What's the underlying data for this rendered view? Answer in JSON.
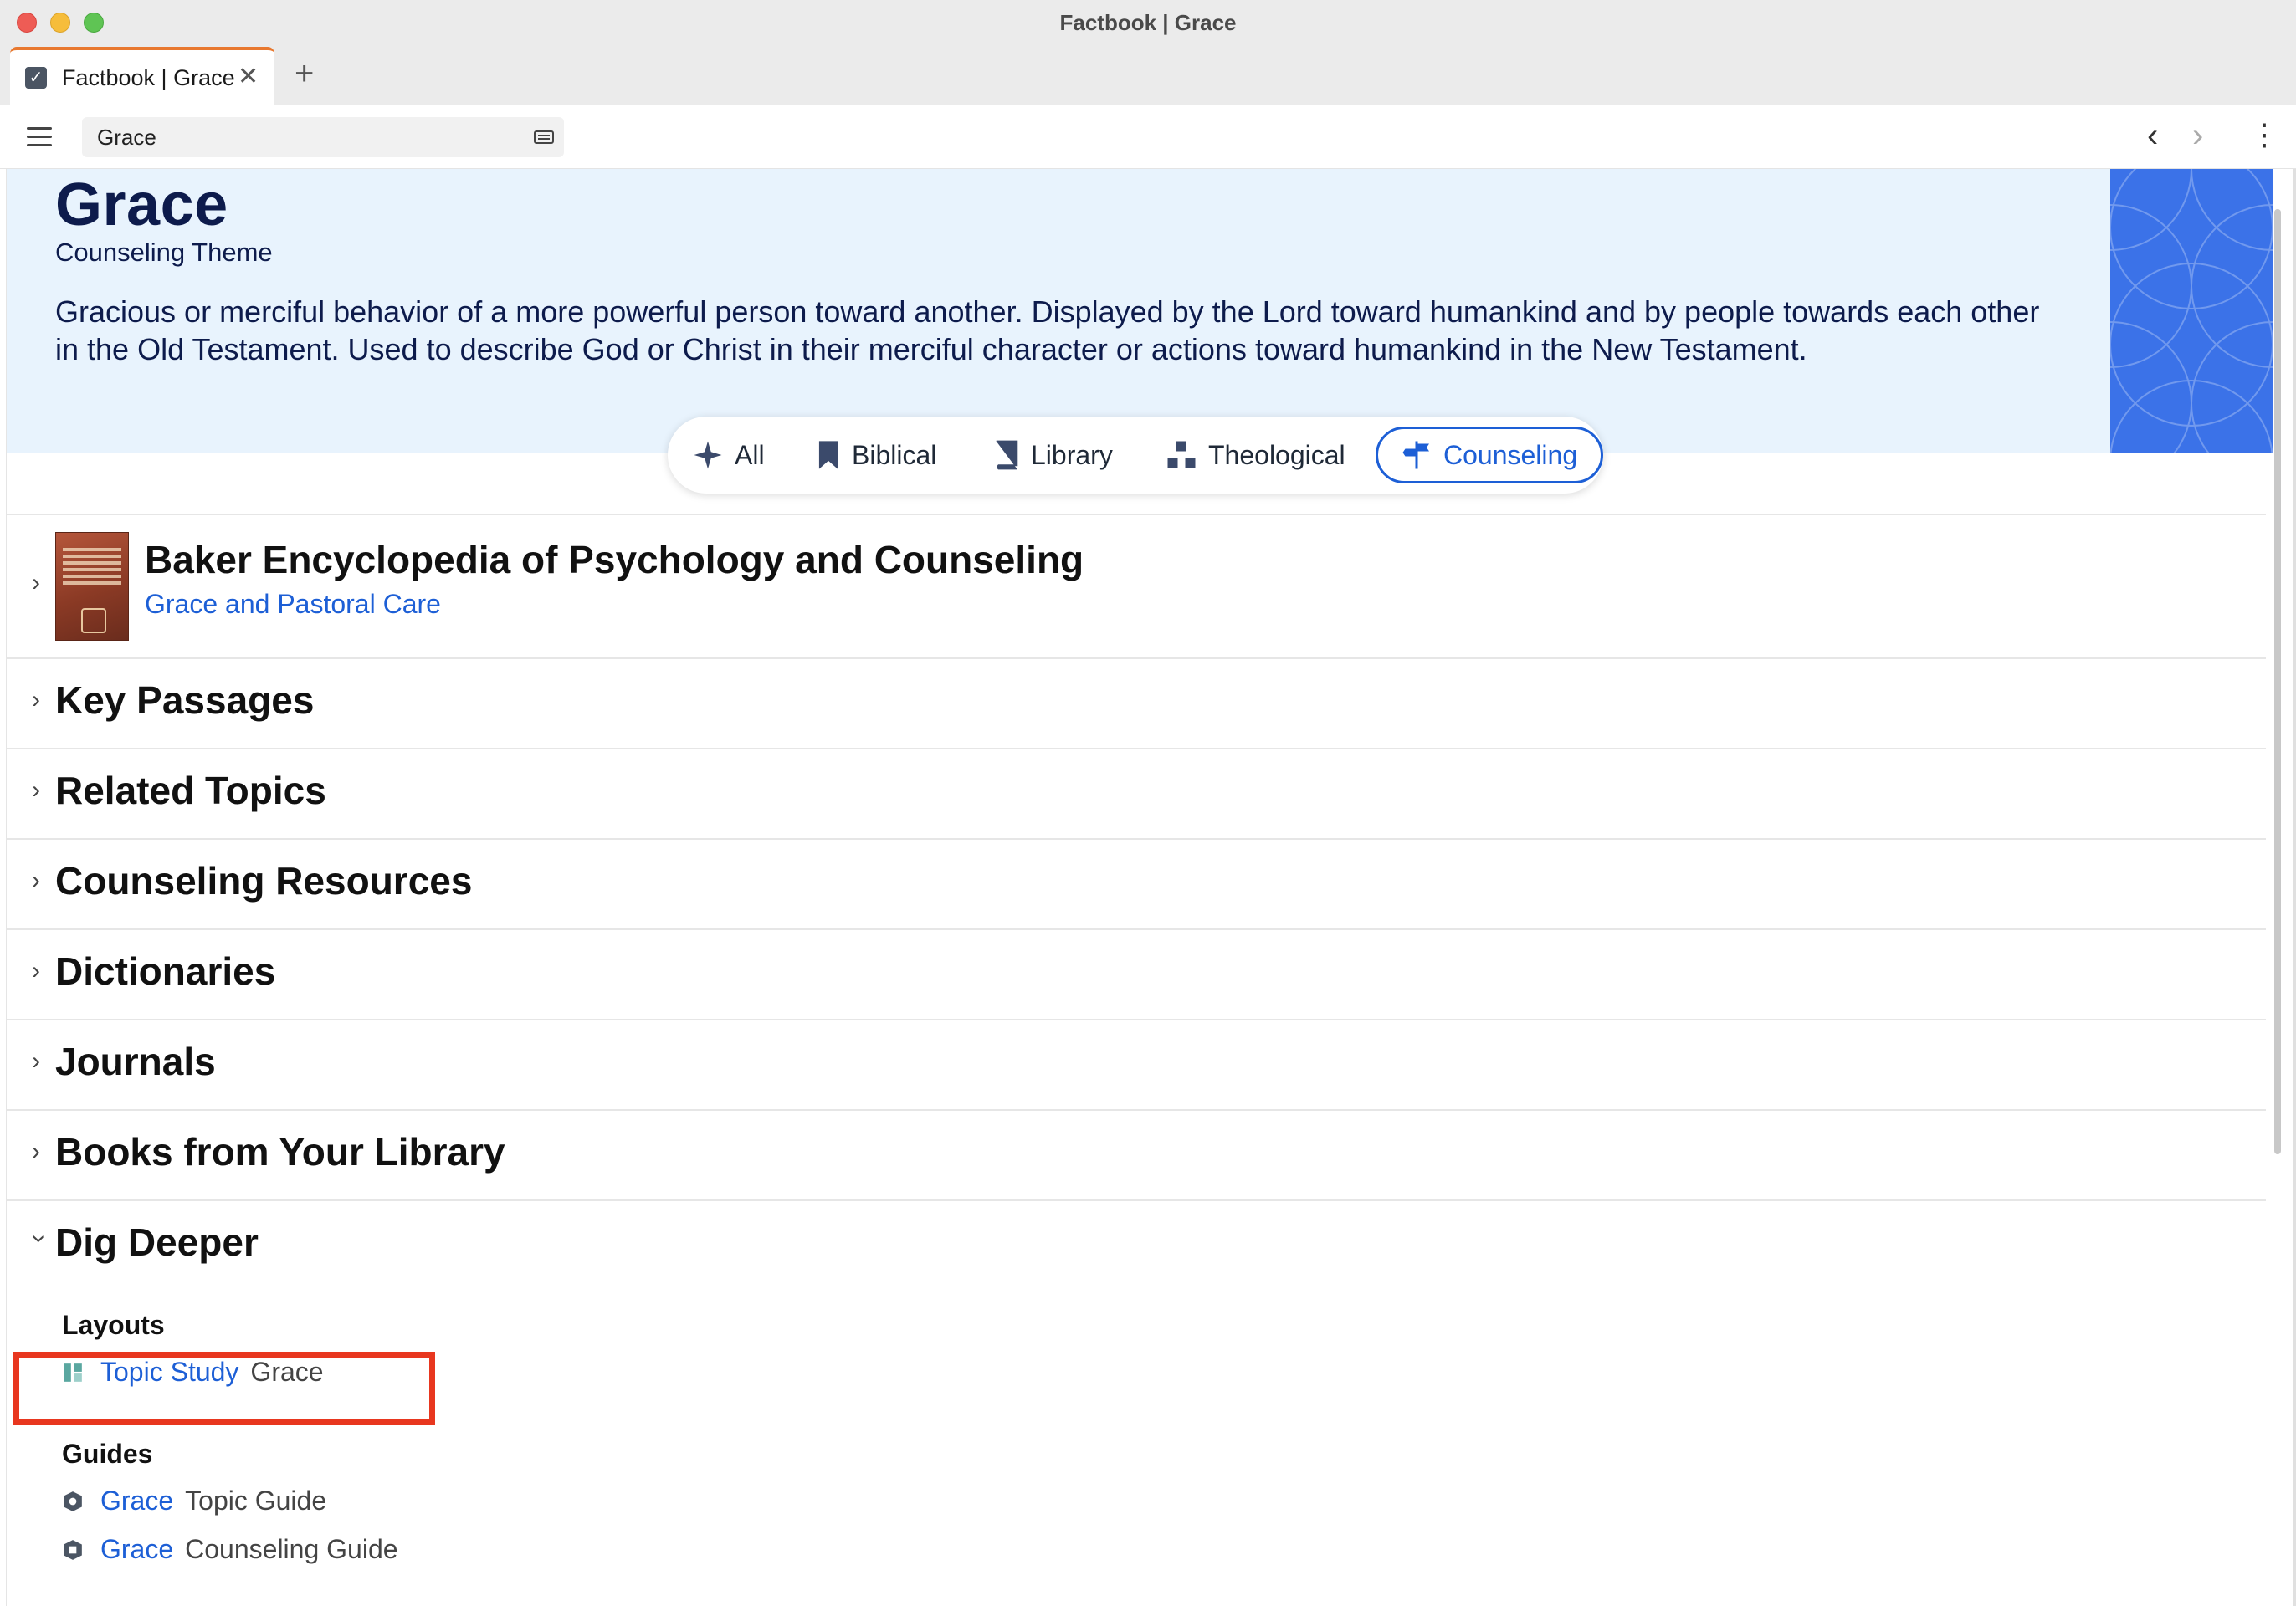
{
  "window": {
    "title": "Factbook | Grace"
  },
  "tab": {
    "title": "Factbook | Grace",
    "close": "✕",
    "add": "+"
  },
  "toolbar": {
    "search_value": "Grace",
    "back": "‹",
    "forward": "›",
    "more": "⋮"
  },
  "hero": {
    "title": "Grace",
    "subtitle": "Counseling Theme",
    "description": "Gracious or merciful behavior of a more powerful person toward another. Displayed by the Lord toward humankind and by people towards each other in the Old Testament. Used to describe God or Christ in their merciful character or actions toward humankind in the New Testament."
  },
  "filters": [
    {
      "label": "All",
      "icon": "sparkle-icon",
      "active": false
    },
    {
      "label": "Biblical",
      "icon": "bookmark-icon",
      "active": false
    },
    {
      "label": "Library",
      "icon": "book-icon",
      "active": false
    },
    {
      "label": "Theological",
      "icon": "blocks-icon",
      "active": false
    },
    {
      "label": "Counseling",
      "icon": "signpost-icon",
      "active": true
    }
  ],
  "featured": {
    "title": "Baker Encyclopedia of Psychology and Counseling",
    "link": "Grace and Pastoral Care"
  },
  "sections": [
    {
      "title": "Key Passages"
    },
    {
      "title": "Related Topics"
    },
    {
      "title": "Counseling Resources"
    },
    {
      "title": "Dictionaries"
    },
    {
      "title": "Journals"
    },
    {
      "title": "Books from Your Library"
    }
  ],
  "dig_deeper": {
    "title": "Dig Deeper",
    "layouts_heading": "Layouts",
    "layouts": [
      {
        "link": "Topic Study",
        "desc": "Grace"
      }
    ],
    "guides_heading": "Guides",
    "guides": [
      {
        "link": "Grace",
        "desc": "Topic Guide"
      },
      {
        "link": "Grace",
        "desc": "Counseling Guide"
      }
    ]
  },
  "colors": {
    "accent": "#1d5fd6",
    "hero_bg": "#e8f3fd",
    "hero_art": "#3b72e8",
    "title_navy": "#0d1b4c",
    "tab_accent": "#e8782f",
    "highlight": "#e8371f"
  }
}
